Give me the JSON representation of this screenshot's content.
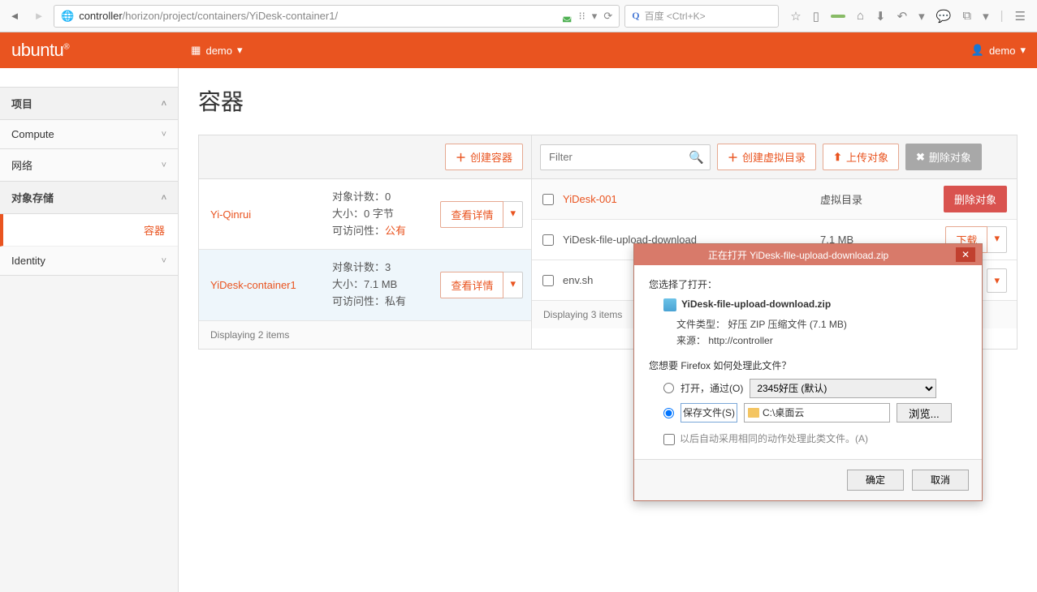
{
  "browser": {
    "url_dark": "controller",
    "url_rest": "/horizon/project/containers/YiDesk-container1/",
    "search_placeholder": "百度 <Ctrl+K>"
  },
  "topbar": {
    "brand": "ubuntu",
    "project_label": "demo",
    "user_label": "demo"
  },
  "sidebar": {
    "project": "项目",
    "compute": "Compute",
    "network": "网络",
    "object_store": "对象存储",
    "containers": "容器",
    "identity": "Identity"
  },
  "page": {
    "title": "容器"
  },
  "left_panel": {
    "create_btn": "创建容器",
    "view_btn": "查看详情",
    "containers": [
      {
        "name": "Yi-Qinrui",
        "count_k": "对象计数：",
        "count_v": "0",
        "size_k": "大小：",
        "size_v": "0 字节",
        "acc_k": "可访问性：",
        "acc_v": "公有",
        "acc_orange": true,
        "selected": false
      },
      {
        "name": "YiDesk-container1",
        "count_k": "对象计数：",
        "count_v": "3",
        "size_k": "大小：",
        "size_v": "7.1 MB",
        "acc_k": "可访问性：",
        "acc_v": "私有",
        "acc_orange": false,
        "selected": true
      }
    ],
    "footer": "Displaying 2 items"
  },
  "right_panel": {
    "filter_placeholder": "Filter",
    "create_pseudo": "创建虚拟目录",
    "upload": "上传对象",
    "delete_all": "删除对象",
    "head_size": "虚拟目录",
    "head_action": "删除对象",
    "download": "下载",
    "objects": [
      {
        "name": "YiDesk-001",
        "link": true,
        "size": "",
        "action": "head"
      },
      {
        "name": "YiDesk-file-upload-download",
        "link": false,
        "size": "7.1 MB",
        "action": "download"
      },
      {
        "name": "env.sh",
        "link": false,
        "size": "",
        "action": "caret"
      }
    ],
    "footer": "Displaying 3 items"
  },
  "dialog": {
    "title": "正在打开 YiDesk-file-upload-download.zip",
    "you_chose": "您选择了打开：",
    "filename": "YiDesk-file-upload-download.zip",
    "type_k": "文件类型：",
    "type_v": "好压 ZIP 压缩文件 (7.1 MB)",
    "src_k": "来源：",
    "src_v": "http://controller",
    "question": "您想要 Firefox 如何处理此文件？",
    "open_label": "打开，通过(O)",
    "open_select": "2345好压 (默认)",
    "save_label": "保存文件(S)",
    "save_path": "C:\\桌面云",
    "browse": "浏览...",
    "remember": "以后自动采用相同的动作处理此类文件。(A)",
    "ok": "确定",
    "cancel": "取消"
  }
}
